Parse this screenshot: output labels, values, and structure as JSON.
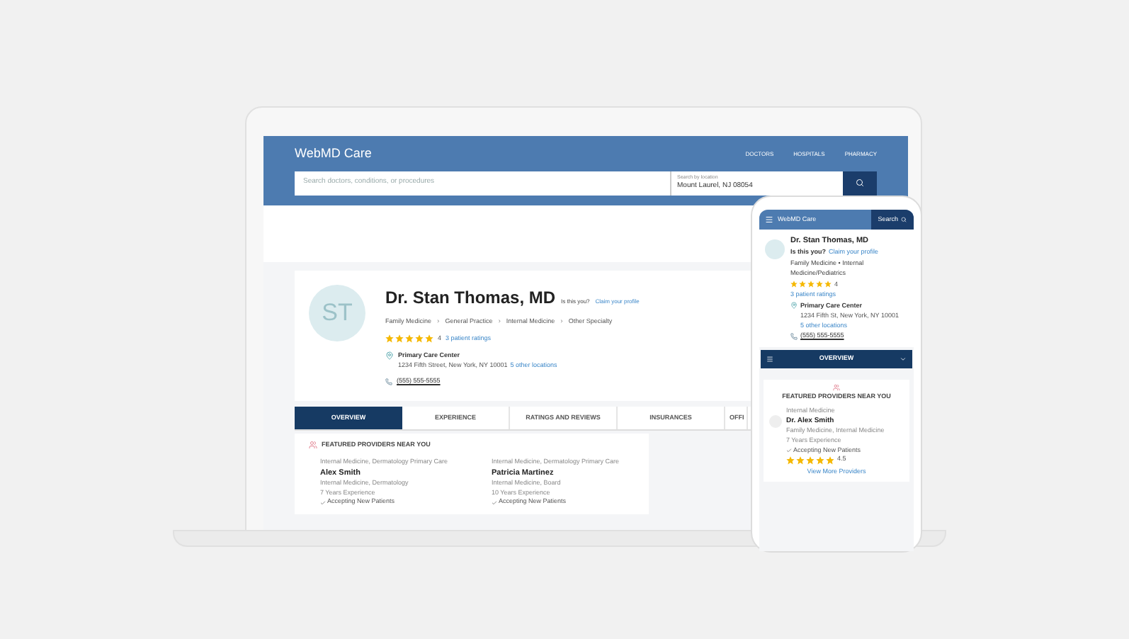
{
  "laptop": {
    "header": {
      "logo": "WebMD Care",
      "nav": [
        "DOCTORS",
        "HOSPITALS",
        "PHARMACY"
      ],
      "search": {
        "placeholder": "Search doctors, conditions, or procedures"
      },
      "location": {
        "label": "Search by location",
        "value": "Mount Laurel, NJ 08054"
      }
    },
    "profile": {
      "initials": "ST",
      "name": "Dr. Stan Thomas, MD",
      "claim_question": "Is this you?",
      "claim_link": "Claim your profile",
      "specialties": [
        "Family Medicine",
        "General Practice",
        "Internal Medicine",
        "Other Specialty"
      ],
      "separator": "›",
      "stars": 5,
      "rating": "4",
      "ratings_link": "3 patient ratings",
      "location_name": "Primary Care Center",
      "address": "1234 Fifth Street, New York, NY 10001",
      "locations_link": "5 other locations",
      "phone": "(555) 555-5555"
    },
    "tabs": [
      {
        "label": "OVERVIEW",
        "selected": true
      },
      {
        "label": "EXPERIENCE",
        "selected": false
      },
      {
        "label": "RATINGS AND REVIEWS",
        "selected": false
      },
      {
        "label": "INSURANCES",
        "selected": false
      },
      {
        "label": "OFFI",
        "selected": false
      }
    ],
    "featured": {
      "title": "FEATURED PROVIDERS NEAR YOU",
      "providers": [
        {
          "caption": "Internal Medicine, Dermatology Primary Care",
          "name": "Alex Smith",
          "specialty": "Internal Medicine, Dermatology",
          "experience": "7 Years Experience",
          "status": "Accepting New Patients"
        },
        {
          "caption": "Internal Medicine, Dermatology Primary Care",
          "name": "Patricia Martinez",
          "specialty": "Internal Medicine, Board",
          "experience": "10 Years Experience",
          "status": "Accepting New Patients"
        }
      ]
    }
  },
  "phone": {
    "header": {
      "logo": "WebMD Care",
      "search": "Search"
    },
    "profile": {
      "name": "Dr. Stan Thomas, MD",
      "claim_question": "Is this you?",
      "claim_link": "Claim your profile",
      "specialties": "Family Medicine • Internal Medicine/Pediatrics",
      "stars": 5,
      "rating": "4",
      "ratings_link": "3 patient ratings",
      "location_name": "Primary Care Center",
      "address": "1234 Fifth St, New York, NY 10001",
      "locations_link": "5 other locations",
      "phone": "(555) 555-5555"
    },
    "section_select": "OVERVIEW",
    "featured": {
      "title": "FEATURED PROVIDERS NEAR YOU",
      "caption": "Internal Medicine",
      "name": "Dr. Alex Smith",
      "specialty": "Family Medicine, Internal Medicine",
      "experience": "7 Years Experience",
      "status": "Accepting New Patients",
      "stars": 5,
      "rating": "4.5",
      "more_link": "View More Providers"
    }
  }
}
